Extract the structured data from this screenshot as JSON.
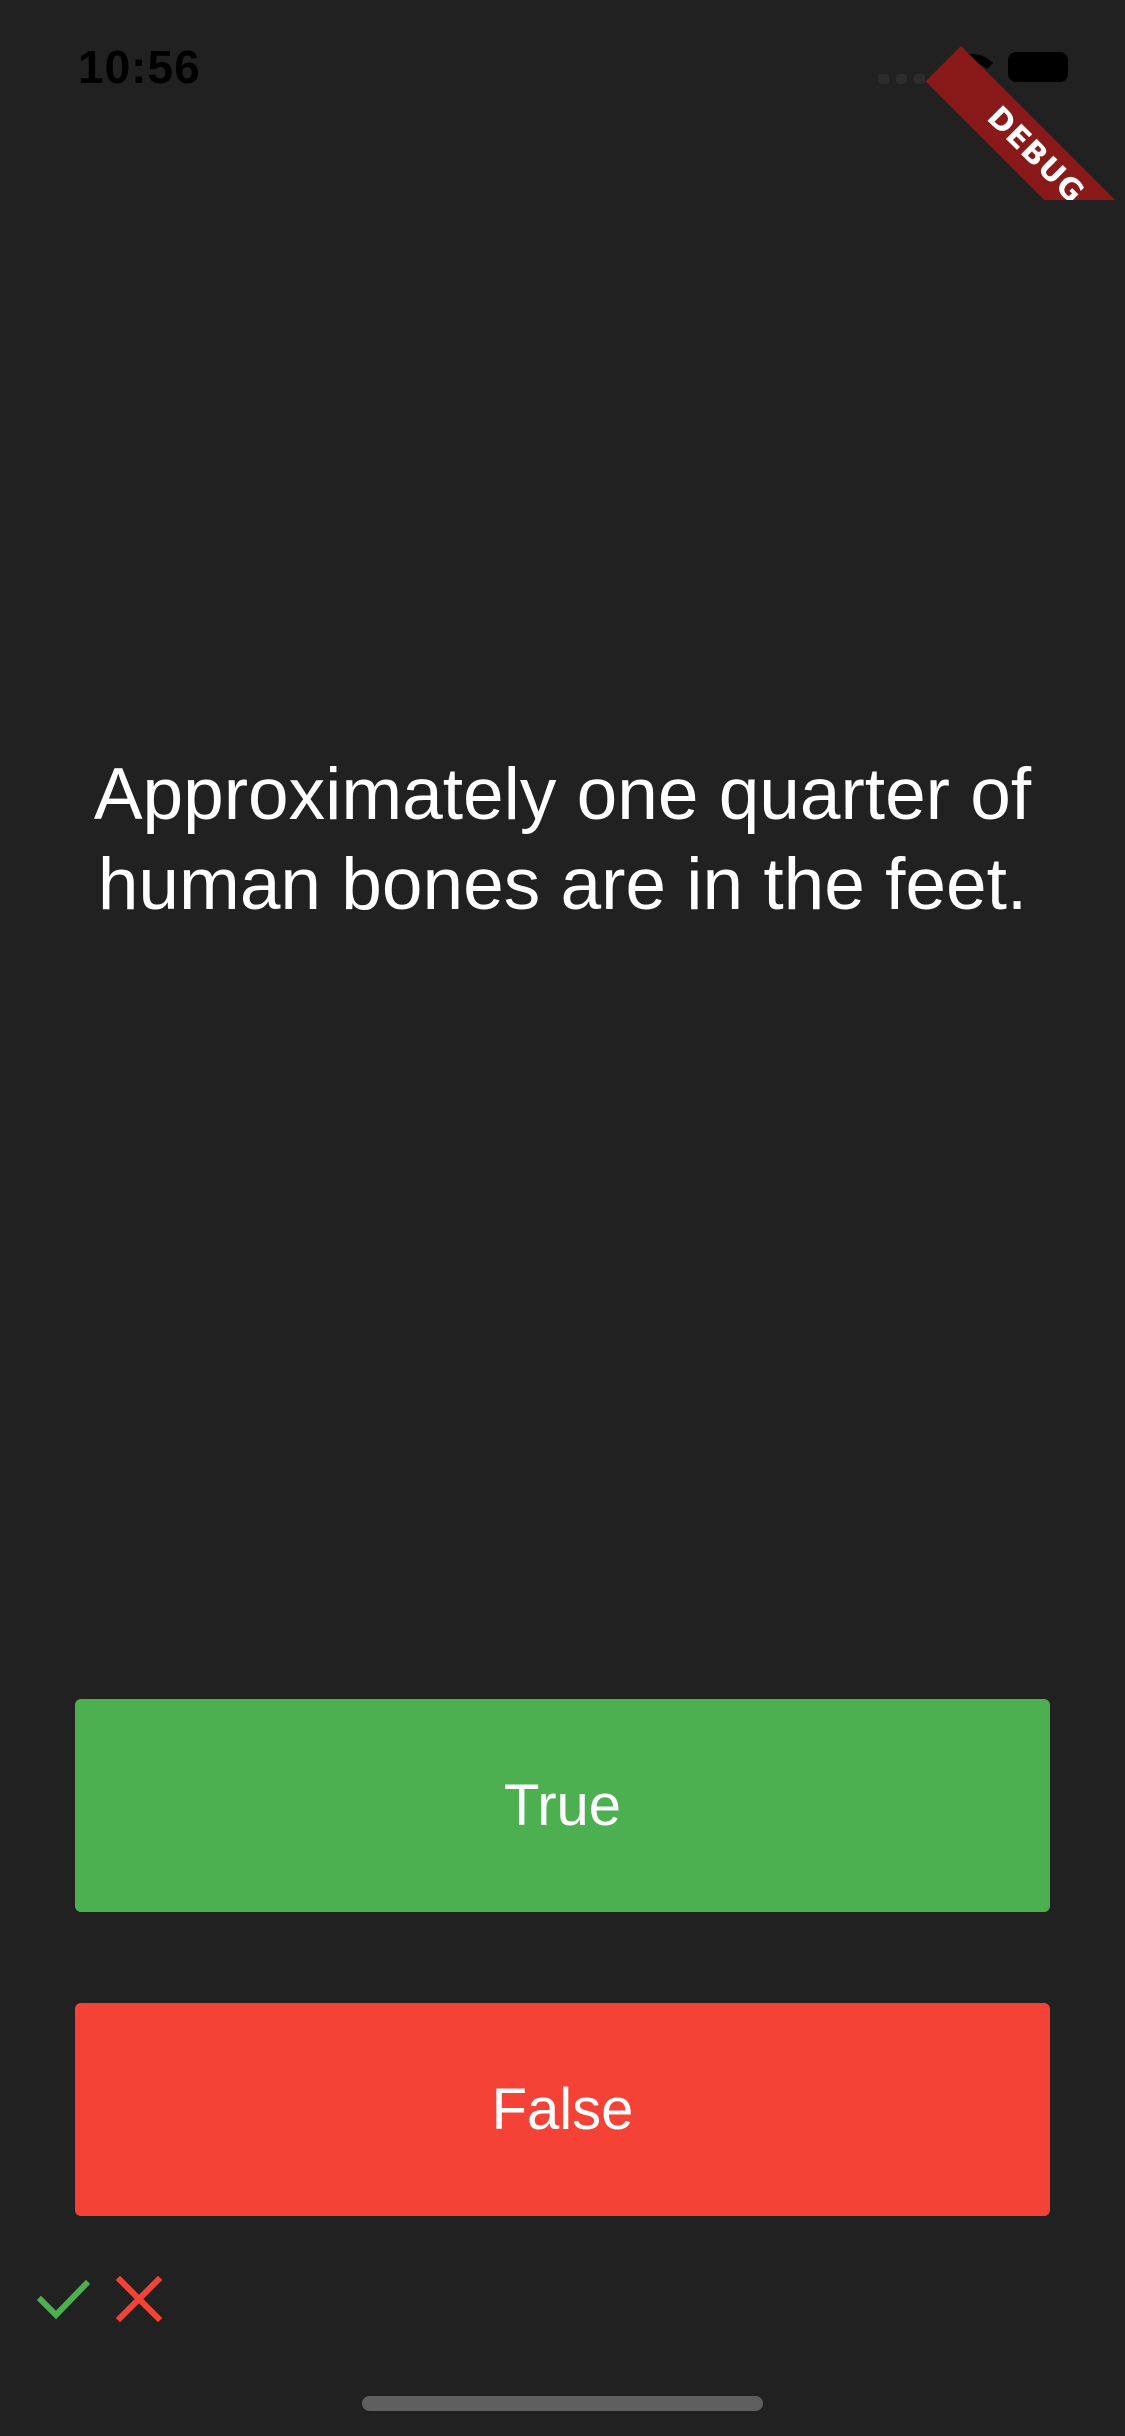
{
  "status_bar": {
    "time": "10:56"
  },
  "debug_banner": {
    "label": "DEBUG",
    "color": "#8a1a1a"
  },
  "quiz": {
    "question": "Approximately one quarter of human bones are in the feet."
  },
  "buttons": {
    "true_label": "True",
    "false_label": "False",
    "true_color": "#4caf50",
    "false_color": "#f44336"
  },
  "score_keeper": [
    {
      "icon": "check-icon",
      "color": "#4caf50"
    },
    {
      "icon": "close-icon",
      "color": "#f44336"
    }
  ],
  "colors": {
    "background": "#212121"
  }
}
